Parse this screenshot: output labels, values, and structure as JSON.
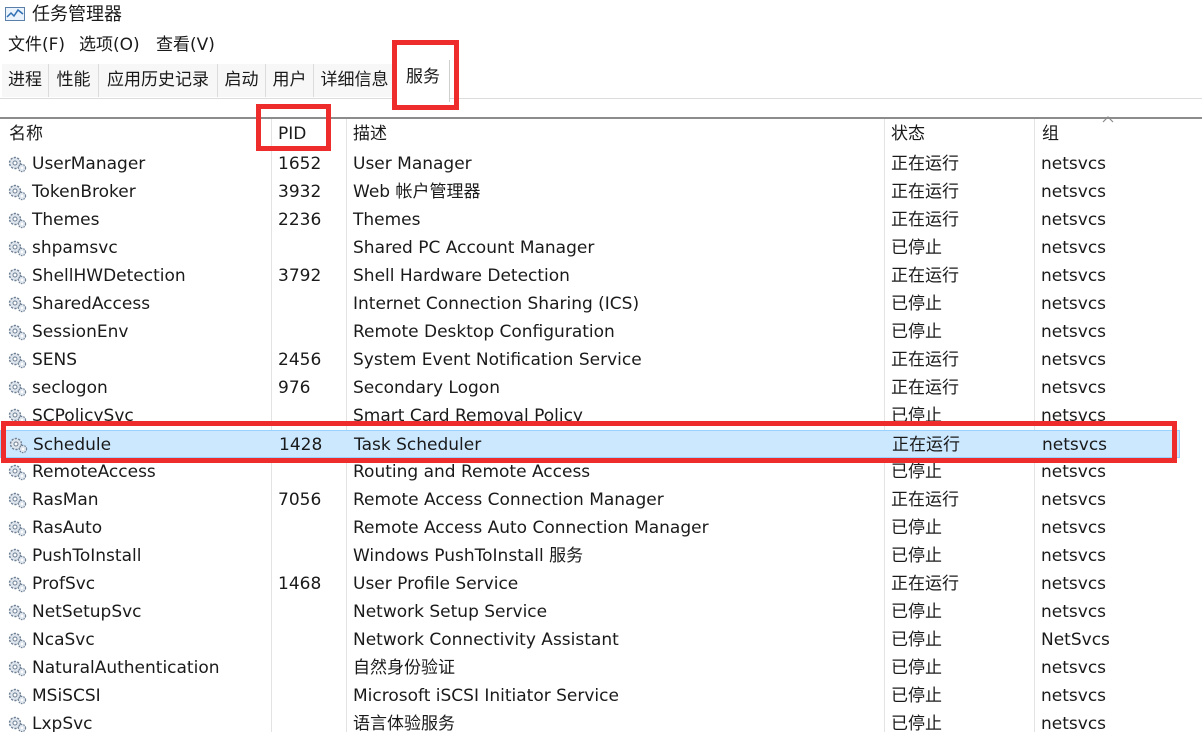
{
  "window": {
    "title": "任务管理器",
    "icon": "task-manager-icon"
  },
  "menu": [
    "文件(F)",
    "选项(O)",
    "查看(V)"
  ],
  "tabs": [
    "进程",
    "性能",
    "应用历史记录",
    "启动",
    "用户",
    "详细信息",
    "服务"
  ],
  "active_tab": "服务",
  "columns": {
    "name": "名称",
    "pid": "PID",
    "desc": "描述",
    "status": "状态",
    "group": "组"
  },
  "rows": [
    {
      "name": "UserManager",
      "pid": "1652",
      "desc": "User Manager",
      "status": "正在运行",
      "group": "netsvcs"
    },
    {
      "name": "TokenBroker",
      "pid": "3932",
      "desc": "Web 帐户管理器",
      "status": "正在运行",
      "group": "netsvcs"
    },
    {
      "name": "Themes",
      "pid": "2236",
      "desc": "Themes",
      "status": "正在运行",
      "group": "netsvcs"
    },
    {
      "name": "shpamsvc",
      "pid": "",
      "desc": "Shared PC Account Manager",
      "status": "已停止",
      "group": "netsvcs"
    },
    {
      "name": "ShellHWDetection",
      "pid": "3792",
      "desc": "Shell Hardware Detection",
      "status": "正在运行",
      "group": "netsvcs"
    },
    {
      "name": "SharedAccess",
      "pid": "",
      "desc": "Internet Connection Sharing (ICS)",
      "status": "已停止",
      "group": "netsvcs"
    },
    {
      "name": "SessionEnv",
      "pid": "",
      "desc": "Remote Desktop Configuration",
      "status": "已停止",
      "group": "netsvcs"
    },
    {
      "name": "SENS",
      "pid": "2456",
      "desc": "System Event Notification Service",
      "status": "正在运行",
      "group": "netsvcs"
    },
    {
      "name": "seclogon",
      "pid": "976",
      "desc": "Secondary Logon",
      "status": "正在运行",
      "group": "netsvcs"
    },
    {
      "name": "SCPolicySvc",
      "pid": "",
      "desc": "Smart Card Removal Policy",
      "status": "已停止",
      "group": "netsvcs"
    },
    {
      "name": "Schedule",
      "pid": "1428",
      "desc": "Task Scheduler",
      "status": "正在运行",
      "group": "netsvcs",
      "selected": true
    },
    {
      "name": "RemoteAccess",
      "pid": "",
      "desc": "Routing and Remote Access",
      "status": "已停止",
      "group": "netsvcs"
    },
    {
      "name": "RasMan",
      "pid": "7056",
      "desc": "Remote Access Connection Manager",
      "status": "正在运行",
      "group": "netsvcs"
    },
    {
      "name": "RasAuto",
      "pid": "",
      "desc": "Remote Access Auto Connection Manager",
      "status": "已停止",
      "group": "netsvcs"
    },
    {
      "name": "PushToInstall",
      "pid": "",
      "desc": "Windows PushToInstall 服务",
      "status": "已停止",
      "group": "netsvcs"
    },
    {
      "name": "ProfSvc",
      "pid": "1468",
      "desc": "User Profile Service",
      "status": "正在运行",
      "group": "netsvcs"
    },
    {
      "name": "NetSetupSvc",
      "pid": "",
      "desc": "Network Setup Service",
      "status": "已停止",
      "group": "netsvcs"
    },
    {
      "name": "NcaSvc",
      "pid": "",
      "desc": "Network Connectivity Assistant",
      "status": "已停止",
      "group": "NetSvcs"
    },
    {
      "name": "NaturalAuthentication",
      "pid": "",
      "desc": "自然身份验证",
      "status": "已停止",
      "group": "netsvcs"
    },
    {
      "name": "MSiSCSI",
      "pid": "",
      "desc": "Microsoft iSCSI Initiator Service",
      "status": "已停止",
      "group": "netsvcs"
    },
    {
      "name": "LxpSvc",
      "pid": "",
      "desc": "语言体验服务",
      "status": "已停止",
      "group": "netsvcs"
    }
  ],
  "colors": {
    "selected_row": "#cce8ff",
    "annotation": "#ee2c2c"
  },
  "icons": {
    "service": "service-gear-icon",
    "sort": "sort-ascending-caret-icon"
  }
}
